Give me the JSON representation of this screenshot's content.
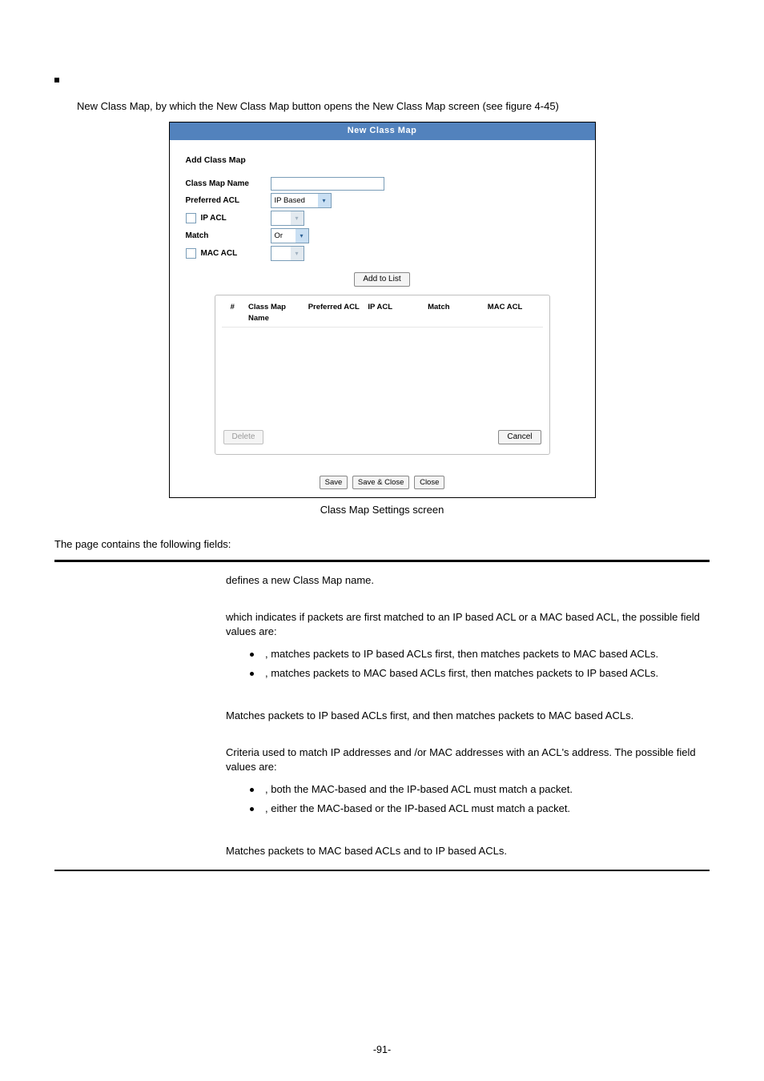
{
  "intro": {
    "line": "New Class Map, by which the New Class Map button opens the New Class Map screen (see figure 4-45)"
  },
  "fig": {
    "title": "New Class Map",
    "heading": "Add Class Map",
    "rows": {
      "class_map_name": "Class Map Name",
      "preferred_acl": "Preferred ACL",
      "ip_acl": "IP ACL",
      "match": "Match",
      "mac_acl": "MAC ACL"
    },
    "preferred_acl_value": "IP Based",
    "match_value": "Or",
    "add_btn": "Add to List",
    "cols": {
      "num": "#",
      "name": "Class Map Name",
      "pref": "Preferred ACL",
      "ip": "IP ACL",
      "match": "Match",
      "mac": "MAC ACL"
    },
    "delete_btn": "Delete",
    "cancel_btn": "Cancel",
    "save_btn": "Save",
    "save_close_btn": "Save & Close",
    "close_btn": "Close"
  },
  "caption": "Class Map Settings screen",
  "defs_intro": "The page contains the following fields:",
  "defs": {
    "r1": {
      "term": "",
      "desc": "defines a new Class Map name."
    },
    "r2": {
      "term": "",
      "desc": "which indicates if packets are first matched to an IP based ACL or a MAC based ACL, the possible field values are:",
      "b1_lead": "",
      "b1": ", matches packets to IP based ACLs first, then matches packets to MAC based ACLs.",
      "b2_lead": "",
      "b2": ", matches packets to MAC based ACLs first, then matches packets to IP based ACLs."
    },
    "r3": {
      "term": "",
      "desc": "Matches packets to IP based ACLs first, and then matches packets to MAC based ACLs."
    },
    "r4": {
      "term": "",
      "desc": "Criteria used to match IP addresses and /or MAC addresses with an ACL's address. The possible field values are:",
      "b1_lead": "",
      "b1": ", both the MAC-based and the IP-based ACL must match a packet.",
      "b2_lead": "",
      "b2": ", either the MAC-based or the IP-based ACL must match a packet."
    },
    "r5": {
      "term": "",
      "desc": "Matches packets to MAC based ACLs and to IP based ACLs."
    }
  },
  "page_number": "-91-"
}
